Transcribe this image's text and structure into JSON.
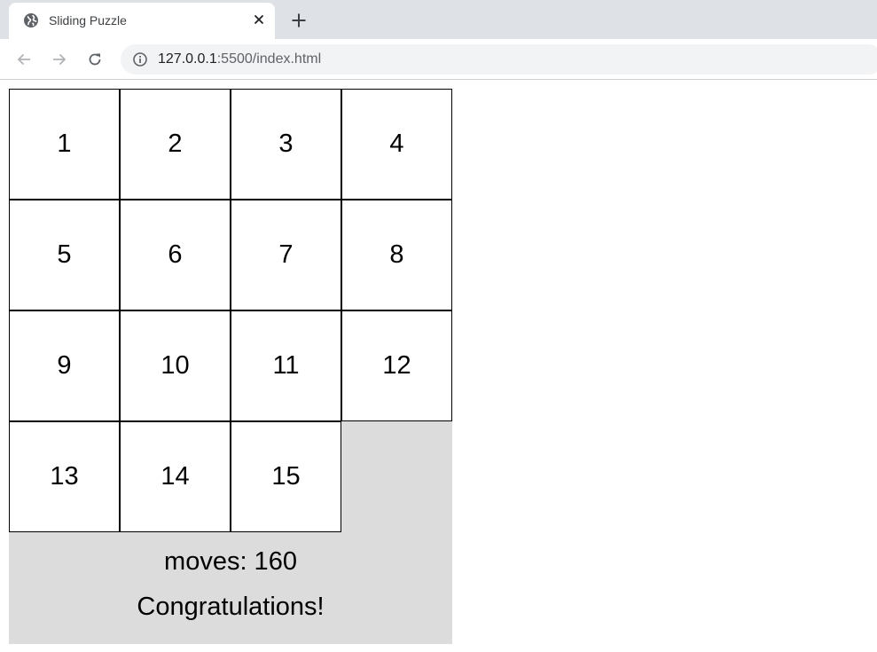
{
  "browser": {
    "tab_title": "Sliding Puzzle",
    "favicon": "globe-icon",
    "close_icon": "close-icon",
    "new_tab_icon": "plus-icon",
    "url_host": "127.0.0.1",
    "url_rest": ":5500/index.html",
    "nav_icons": [
      "back-arrow-icon",
      "forward-arrow-icon",
      "reload-icon",
      "info-icon"
    ]
  },
  "puzzle": {
    "tiles": [
      "1",
      "2",
      "3",
      "4",
      "5",
      "6",
      "7",
      "8",
      "9",
      "10",
      "11",
      "12",
      "13",
      "14",
      "15",
      ""
    ],
    "moves_label": "moves: 160",
    "message": "Congratulations!",
    "colors": {
      "tile_background": "#ffffff",
      "tile_border": "#000000",
      "board_background": "#dcdcdc"
    }
  }
}
